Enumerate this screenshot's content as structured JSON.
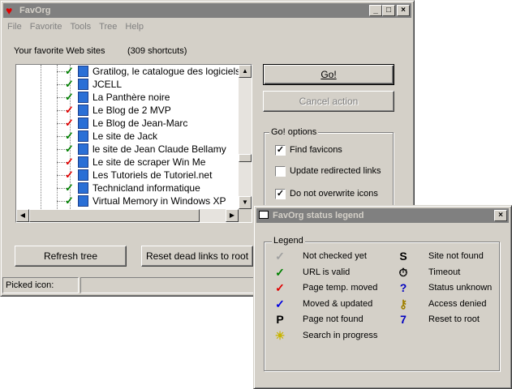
{
  "main_window": {
    "title": "FavOrg",
    "controls": {
      "minimize": "_",
      "maximize": "□",
      "close": "×"
    },
    "menu": [
      "File",
      "Favorite",
      "Tools",
      "Tree",
      "Help"
    ],
    "favorites_label": "Your favorite Web sites",
    "shortcuts_count": "(309 shortcuts)",
    "tree_items": [
      {
        "label": "Gratilog, le catalogue des logiciels grat",
        "status": "valid"
      },
      {
        "label": "JCELL",
        "status": "valid"
      },
      {
        "label": "La Panthère noire",
        "status": "valid"
      },
      {
        "label": "Le Blog de 2 MVP",
        "status": "temp-moved"
      },
      {
        "label": "Le Blog de Jean-Marc",
        "status": "temp-moved"
      },
      {
        "label": "Le site de Jack",
        "status": "valid"
      },
      {
        "label": "le site de Jean Claude Bellamy",
        "status": "valid"
      },
      {
        "label": "Le site de scraper Win Me",
        "status": "temp-moved"
      },
      {
        "label": "Les Tutoriels de Tutoriel.net",
        "status": "temp-moved"
      },
      {
        "label": "Technicland informatique",
        "status": "valid"
      },
      {
        "label": "Virtual Memory in Windows XP",
        "status": "valid"
      }
    ],
    "go_button": "Go!",
    "cancel_button": "Cancel action",
    "options_group": "Go! options",
    "options": [
      {
        "label": "Find favicons",
        "checked": true
      },
      {
        "label": "Update redirected links",
        "checked": false
      },
      {
        "label": "Do not overwrite icons",
        "checked": true
      }
    ],
    "refresh_button": "Refresh tree",
    "reset_button": "Reset dead links to root",
    "picked_icon_label": "Picked icon:"
  },
  "legend_window": {
    "title": "FavOrg status legend",
    "close": "×",
    "group_label": "Legend",
    "left_items": [
      {
        "icon": "not-checked-icon",
        "glyph": "✓",
        "color": "#a0a0a0",
        "label": "Not checked yet"
      },
      {
        "icon": "valid-check-icon",
        "glyph": "✓",
        "color": "#008000",
        "label": "URL is valid"
      },
      {
        "icon": "temp-moved-check-icon",
        "glyph": "✓",
        "color": "#e00000",
        "label": "Page temp. moved"
      },
      {
        "icon": "moved-updated-check-icon",
        "glyph": "✓",
        "color": "#0000e0",
        "label": "Moved & updated"
      },
      {
        "icon": "page-not-found-icon",
        "glyph": "P",
        "color": "#000000",
        "label": "Page not found"
      },
      {
        "icon": "search-progress-icon",
        "glyph": "☀",
        "color": "#c8b400",
        "label": "Search in progress"
      }
    ],
    "right_items": [
      {
        "icon": "site-not-found-icon",
        "glyph": "S",
        "color": "#000000",
        "label": "Site not found"
      },
      {
        "icon": "timeout-icon",
        "glyph": "⏱",
        "color": "#000000",
        "label": "Timeout"
      },
      {
        "icon": "status-unknown-icon",
        "glyph": "?",
        "color": "#0000c0",
        "label": "Status unknown"
      },
      {
        "icon": "access-denied-icon",
        "glyph": "⚷",
        "color": "#a08000",
        "label": "Access denied"
      },
      {
        "icon": "reset-root-icon",
        "glyph": "7",
        "color": "#0000c0",
        "label": "Reset to root"
      }
    ]
  }
}
